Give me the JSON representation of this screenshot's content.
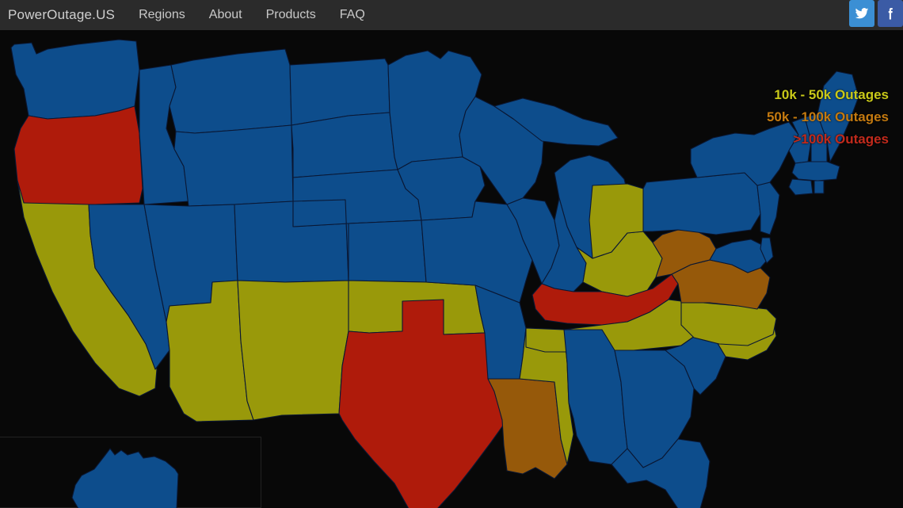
{
  "header": {
    "brand": "PowerOutage.US",
    "nav": [
      {
        "label": "Regions"
      },
      {
        "label": "About"
      },
      {
        "label": "Products"
      },
      {
        "label": "FAQ"
      }
    ],
    "social": [
      {
        "name": "twitter-icon",
        "glyph": "🐦"
      },
      {
        "name": "facebook-icon",
        "glyph": "f"
      }
    ],
    "bg_color": "#2b2b2b"
  },
  "legend": {
    "items": [
      {
        "label": "10k - 50k Outages",
        "color": "#c9c919"
      },
      {
        "label": "50k - 100k Outages",
        "color": "#c47a10"
      },
      {
        "label": ">100k Outages",
        "color": "#c22a1c"
      }
    ]
  },
  "map": {
    "background": "#080808",
    "border_color": "#0a1733",
    "severity_colors": {
      "none": "#0d4d8c",
      "low": "#99990a",
      "medium": "#96590a",
      "high": "#af1b0b"
    },
    "states": [
      {
        "code": "WA",
        "name": "Washington",
        "severity": "none",
        "color": "#0d4d8c"
      },
      {
        "code": "OR",
        "name": "Oregon",
        "severity": "high",
        "color": "#af1b0b"
      },
      {
        "code": "CA",
        "name": "California",
        "severity": "low",
        "color": "#99990a"
      },
      {
        "code": "ID",
        "name": "Idaho",
        "severity": "none",
        "color": "#0d4d8c"
      },
      {
        "code": "NV",
        "name": "Nevada",
        "severity": "none",
        "color": "#0d4d8c"
      },
      {
        "code": "MT",
        "name": "Montana",
        "severity": "none",
        "color": "#0d4d8c"
      },
      {
        "code": "WY",
        "name": "Wyoming",
        "severity": "none",
        "color": "#0d4d8c"
      },
      {
        "code": "UT",
        "name": "Utah",
        "severity": "none",
        "color": "#0d4d8c"
      },
      {
        "code": "AZ",
        "name": "Arizona",
        "severity": "low",
        "color": "#99990a"
      },
      {
        "code": "CO",
        "name": "Colorado",
        "severity": "none",
        "color": "#0d4d8c"
      },
      {
        "code": "NM",
        "name": "New Mexico",
        "severity": "low",
        "color": "#99990a"
      },
      {
        "code": "ND",
        "name": "North Dakota",
        "severity": "none",
        "color": "#0d4d8c"
      },
      {
        "code": "SD",
        "name": "South Dakota",
        "severity": "none",
        "color": "#0d4d8c"
      },
      {
        "code": "NE",
        "name": "Nebraska",
        "severity": "none",
        "color": "#0d4d8c"
      },
      {
        "code": "KS",
        "name": "Kansas",
        "severity": "none",
        "color": "#0d4d8c"
      },
      {
        "code": "OK",
        "name": "Oklahoma",
        "severity": "low",
        "color": "#99990a"
      },
      {
        "code": "TX",
        "name": "Texas",
        "severity": "high",
        "color": "#af1b0b"
      },
      {
        "code": "MN",
        "name": "Minnesota",
        "severity": "none",
        "color": "#0d4d8c"
      },
      {
        "code": "IA",
        "name": "Iowa",
        "severity": "none",
        "color": "#0d4d8c"
      },
      {
        "code": "MO",
        "name": "Missouri",
        "severity": "none",
        "color": "#0d4d8c"
      },
      {
        "code": "AR",
        "name": "Arkansas",
        "severity": "none",
        "color": "#0d4d8c"
      },
      {
        "code": "LA",
        "name": "Louisiana",
        "severity": "medium",
        "color": "#96590a"
      },
      {
        "code": "WI",
        "name": "Wisconsin",
        "severity": "none",
        "color": "#0d4d8c"
      },
      {
        "code": "IL",
        "name": "Illinois",
        "severity": "none",
        "color": "#0d4d8c"
      },
      {
        "code": "MS",
        "name": "Mississippi",
        "severity": "low",
        "color": "#99990a"
      },
      {
        "code": "MI",
        "name": "Michigan",
        "severity": "none",
        "color": "#0d4d8c"
      },
      {
        "code": "IN",
        "name": "Indiana",
        "severity": "none",
        "color": "#0d4d8c"
      },
      {
        "code": "OH",
        "name": "Ohio",
        "severity": "low",
        "color": "#99990a"
      },
      {
        "code": "KY",
        "name": "Kentucky",
        "severity": "high",
        "color": "#af1b0b"
      },
      {
        "code": "TN",
        "name": "Tennessee",
        "severity": "low",
        "color": "#99990a"
      },
      {
        "code": "AL",
        "name": "Alabama",
        "severity": "none",
        "color": "#0d4d8c"
      },
      {
        "code": "GA",
        "name": "Georgia",
        "severity": "none",
        "color": "#0d4d8c"
      },
      {
        "code": "FL",
        "name": "Florida",
        "severity": "none",
        "color": "#0d4d8c"
      },
      {
        "code": "SC",
        "name": "South Carolina",
        "severity": "none",
        "color": "#0d4d8c"
      },
      {
        "code": "NC",
        "name": "North Carolina",
        "severity": "low",
        "color": "#99990a"
      },
      {
        "code": "VA",
        "name": "Virginia",
        "severity": "medium",
        "color": "#96590a"
      },
      {
        "code": "WV",
        "name": "West Virginia",
        "severity": "medium",
        "color": "#96590a"
      },
      {
        "code": "MD",
        "name": "Maryland",
        "severity": "none",
        "color": "#0d4d8c"
      },
      {
        "code": "DE",
        "name": "Delaware",
        "severity": "none",
        "color": "#0d4d8c"
      },
      {
        "code": "PA",
        "name": "Pennsylvania",
        "severity": "none",
        "color": "#0d4d8c"
      },
      {
        "code": "NJ",
        "name": "New Jersey",
        "severity": "none",
        "color": "#0d4d8c"
      },
      {
        "code": "NY",
        "name": "New York",
        "severity": "none",
        "color": "#0d4d8c"
      },
      {
        "code": "CT",
        "name": "Connecticut",
        "severity": "none",
        "color": "#0d4d8c"
      },
      {
        "code": "RI",
        "name": "Rhode Island",
        "severity": "none",
        "color": "#0d4d8c"
      },
      {
        "code": "MA",
        "name": "Massachusetts",
        "severity": "none",
        "color": "#0d4d8c"
      },
      {
        "code": "VT",
        "name": "Vermont",
        "severity": "none",
        "color": "#0d4d8c"
      },
      {
        "code": "NH",
        "name": "New Hampshire",
        "severity": "none",
        "color": "#0d4d8c"
      },
      {
        "code": "ME",
        "name": "Maine",
        "severity": "none",
        "color": "#0d4d8c"
      },
      {
        "code": "AK",
        "name": "Alaska",
        "severity": "none",
        "color": "#0d4d8c"
      }
    ]
  }
}
